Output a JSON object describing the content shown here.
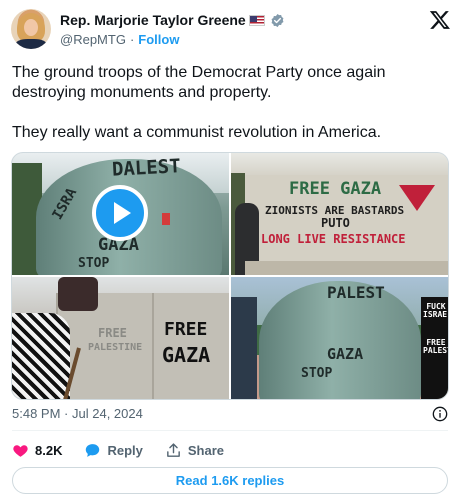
{
  "author": {
    "display_name": "Rep. Marjorie Taylor Greene",
    "handle": "@RepMTG",
    "separator": "·",
    "follow_label": "Follow",
    "flag_icon": "us-flag-icon",
    "verified_icon": "verified-badge-icon",
    "verified_color": "#829aab"
  },
  "brand_icon": "x-logo-icon",
  "tweet": {
    "text": "The ground troops of the Democrat Party once again destroying monuments and property.\n\nThey really want a communist revolution in America."
  },
  "media": {
    "photos": [
      {
        "graffiti": [
          "DALEST",
          "ISRA",
          "GAZA",
          "STOP"
        ],
        "has_play_button": true,
        "play_icon": "play-icon"
      },
      {
        "graffiti": [
          "FREE GAZA",
          "ZIONISTS ARE BASTARDS",
          "PUTO",
          "LONG LIVE RESISTANCE"
        ]
      },
      {
        "graffiti": [
          "FREE",
          "GAZA",
          "FREE",
          "PALESTINE"
        ]
      },
      {
        "graffiti": [
          "PALEST",
          "GAZA",
          "STOP",
          "FUCK ISRAEL",
          "FREE PALESTINE"
        ]
      }
    ]
  },
  "meta": {
    "time": "5:48 PM",
    "separator": "·",
    "date": "Jul 24, 2024",
    "info_icon": "info-icon"
  },
  "actions": {
    "like_count": "8.2K",
    "like_icon": "heart-icon",
    "like_color": "#f91880",
    "reply_label": "Reply",
    "reply_icon": "speech-bubble-icon",
    "reply_color": "#1d9bf0",
    "share_label": "Share",
    "share_icon": "share-icon"
  },
  "read_replies_label": "Read 1.6K replies",
  "colors": {
    "accent": "#1d9bf0",
    "text_primary": "#0f1419",
    "text_secondary": "#536471",
    "border": "#cfd9de"
  }
}
